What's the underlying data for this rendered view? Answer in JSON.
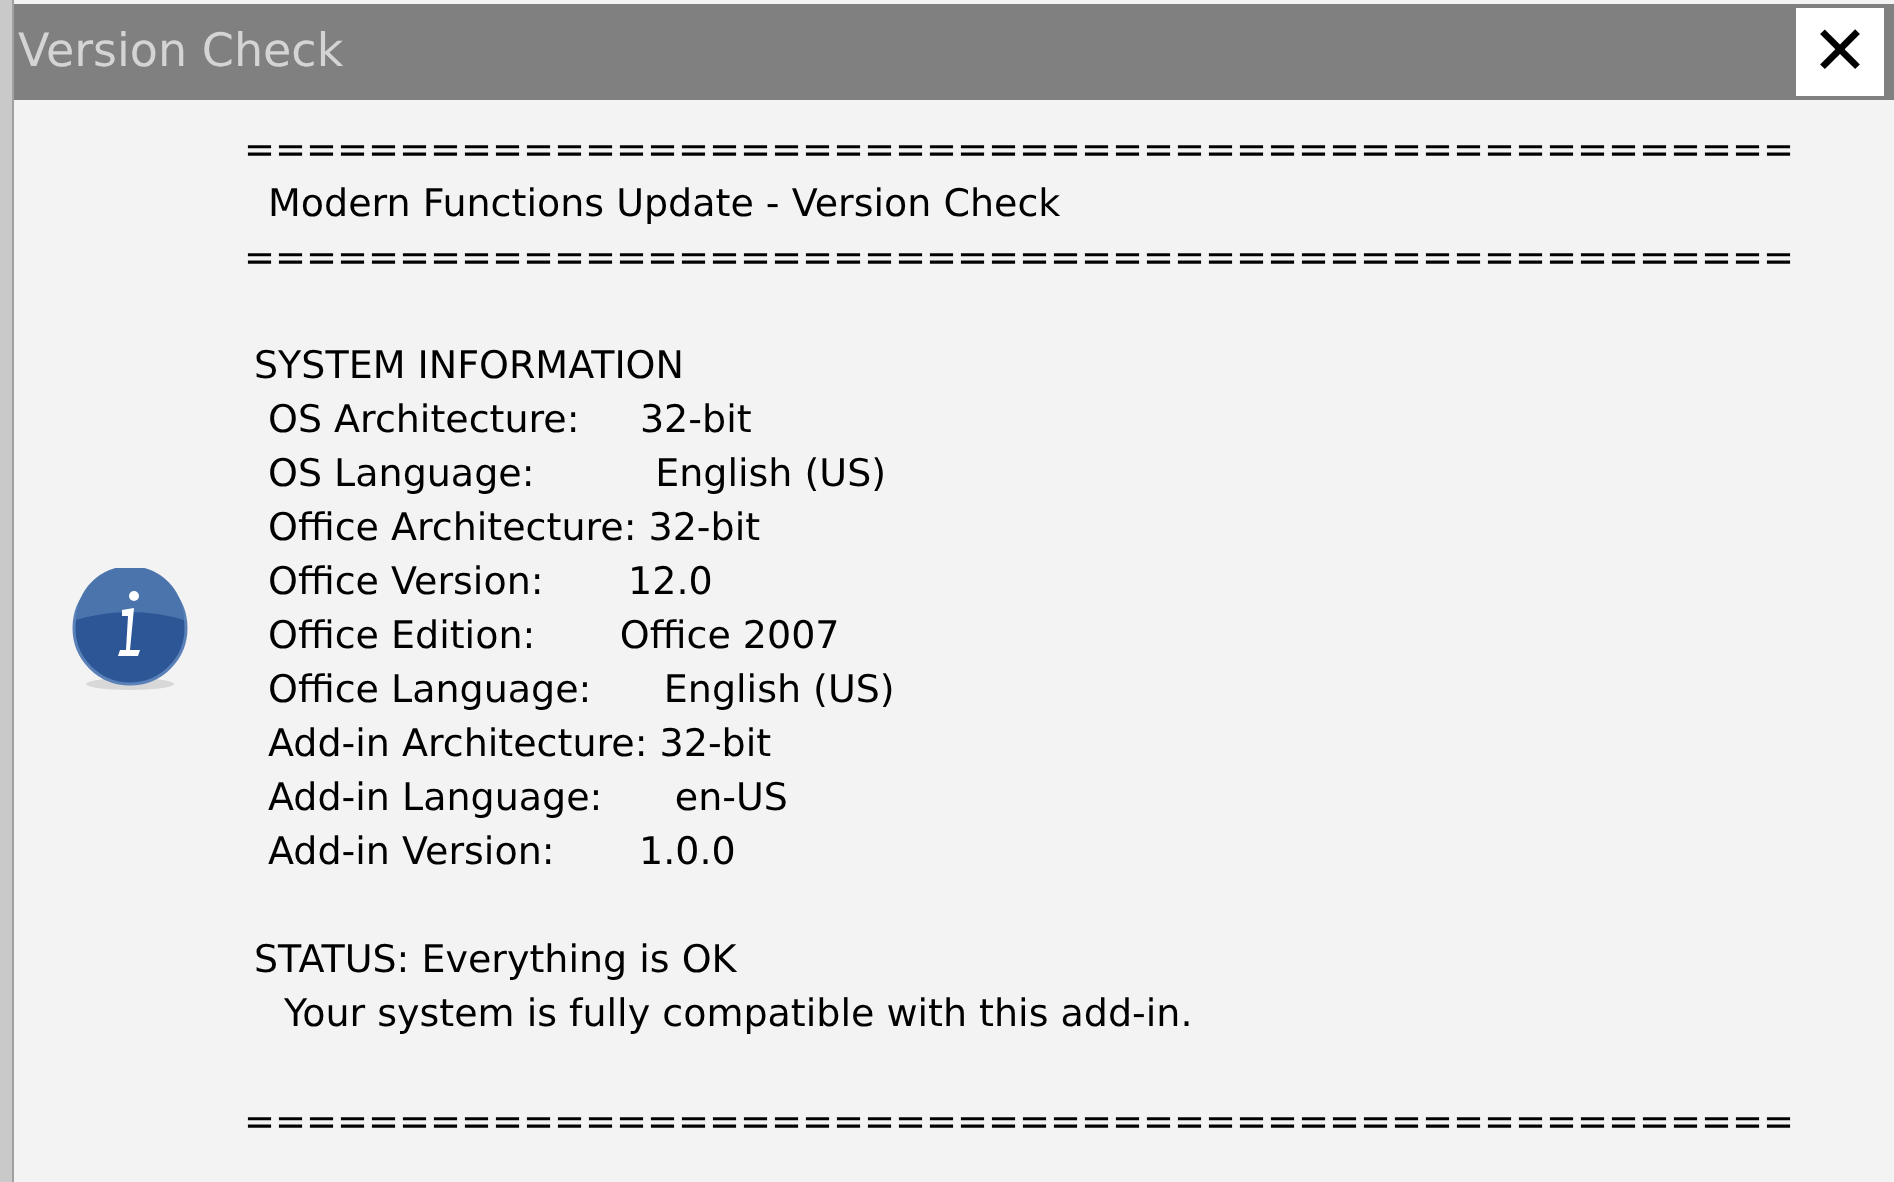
{
  "window": {
    "title": "Version Check",
    "close": "✕"
  },
  "lines": [
    {
      "kind": "rule",
      "text": "=================================================="
    },
    {
      "kind": "title",
      "text": "Modern Functions Update - Version Check"
    },
    {
      "kind": "rule",
      "text": "=================================================="
    },
    {
      "kind": "heading",
      "text": "SYSTEM INFORMATION"
    },
    {
      "kind": "item",
      "text": "OS Architecture:     32-bit"
    },
    {
      "kind": "item",
      "text": "OS Language:          English (US)"
    },
    {
      "kind": "item",
      "text": "Office Architecture: 32-bit"
    },
    {
      "kind": "item",
      "text": "Office Version:       12.0"
    },
    {
      "kind": "item",
      "text": "Office Edition:       Office 2007"
    },
    {
      "kind": "item",
      "text": "Office Language:      English (US)"
    },
    {
      "kind": "item",
      "text": "Add-in Architecture: 32-bit"
    },
    {
      "kind": "item",
      "text": "Add-in Language:      en-US"
    },
    {
      "kind": "item",
      "text": "Add-in Version:       1.0.0"
    },
    {
      "kind": "heading",
      "text": "STATUS: Everything is OK"
    },
    {
      "kind": "text",
      "text": "Your system is fully compatible with this add-in."
    },
    {
      "kind": "rule",
      "text": "=================================================="
    }
  ]
}
